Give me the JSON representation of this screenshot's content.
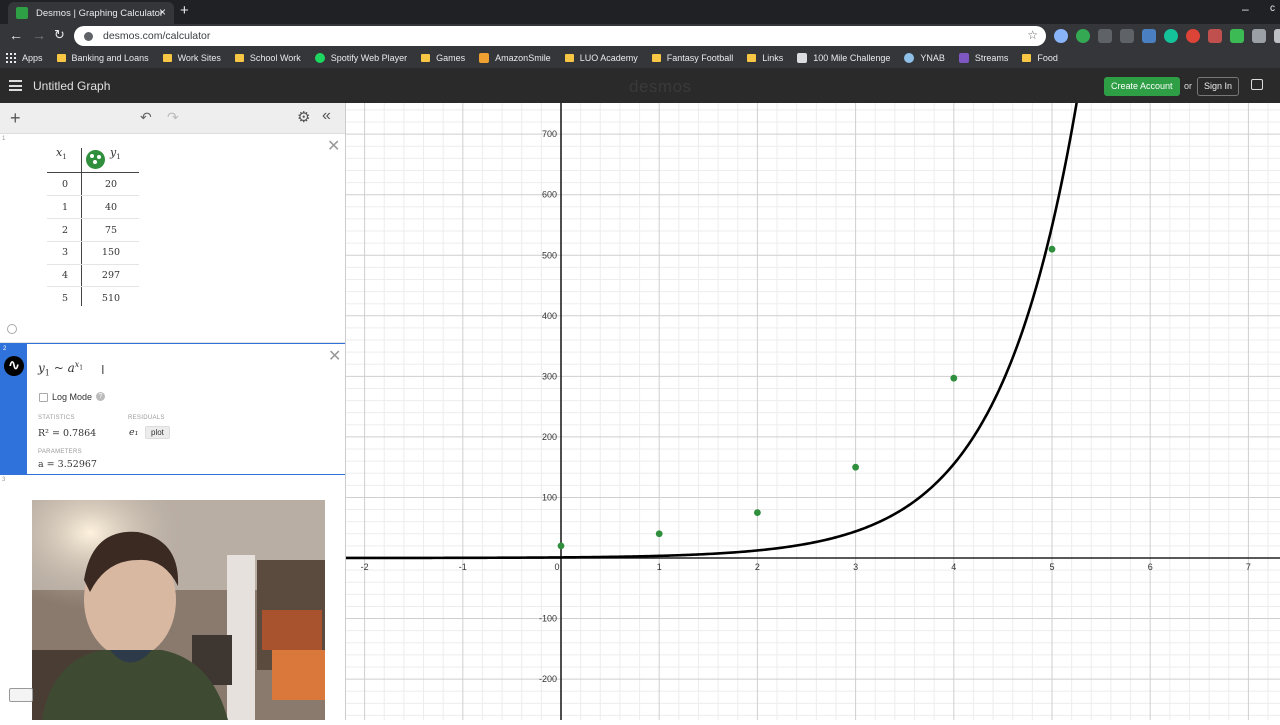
{
  "browser": {
    "tab_title": "Desmos | Graphing Calculator",
    "url": "desmos.com/calculator",
    "bookmarks": [
      "Apps",
      "Banking and Loans",
      "Work Sites",
      "School Work",
      "Spotify Web Player",
      "Games",
      "AmazonSmile",
      "LUO Academy",
      "Fantasy Football",
      "Links",
      "100 Mile Challenge",
      "YNAB",
      "Streams",
      "Food"
    ]
  },
  "header": {
    "title": "Untitled Graph",
    "logo": "desmos",
    "create_account": "Create Account",
    "or": "or",
    "sign_in": "Sign In"
  },
  "expressions": {
    "table": {
      "row_number": "1",
      "col_x": "x",
      "col_x_sub": "1",
      "col_y": "y",
      "col_y_sub": "1",
      "x_values": [
        "0",
        "1",
        "2",
        "3",
        "4",
        "5"
      ],
      "y_values": [
        "20",
        "40",
        "75",
        "150",
        "297",
        "510"
      ],
      "point_color": "#2f8f3d"
    },
    "regression": {
      "row_number": "2",
      "formula_lhs": "y",
      "formula_lhs_sub": "1",
      "formula_op": " ~ ",
      "formula_base": "a",
      "formula_exp": "x",
      "formula_exp_sub": "1",
      "log_mode": "Log Mode",
      "statistics_label": "STATISTICS",
      "r2_text": "R² = 0.7864",
      "residuals_label": "RESIDUALS",
      "residual_var": "e₁",
      "plot_label": "plot",
      "parameters_label": "PARAMETERS",
      "a_text": "a = 3.52967"
    },
    "empty_row_number": "3"
  },
  "graph": {
    "x_ticks": [
      "-2",
      "-1",
      "0",
      "1",
      "2",
      "3",
      "4",
      "5",
      "6",
      "7"
    ],
    "y_ticks": [
      "700",
      "600",
      "500",
      "400",
      "300",
      "200",
      "100",
      "-100",
      "-200"
    ],
    "curve_color": "#000000",
    "point_color": "#2f8f3d"
  },
  "chart_data": {
    "type": "scatter",
    "title": "",
    "xlabel": "",
    "ylabel": "",
    "xlim": [
      -2.2,
      7.3
    ],
    "ylim": [
      -250,
      750
    ],
    "grid": true,
    "series": [
      {
        "name": "",
        "type": "scatter",
        "x": [
          0,
          1,
          2,
          3,
          4,
          5
        ],
        "y": [
          20,
          40,
          75,
          150,
          297,
          510
        ],
        "color": "#2f8f3d"
      },
      {
        "name": "",
        "type": "line",
        "function": "y = a^x",
        "a": 3.52967,
        "color": "#000000"
      }
    ]
  }
}
